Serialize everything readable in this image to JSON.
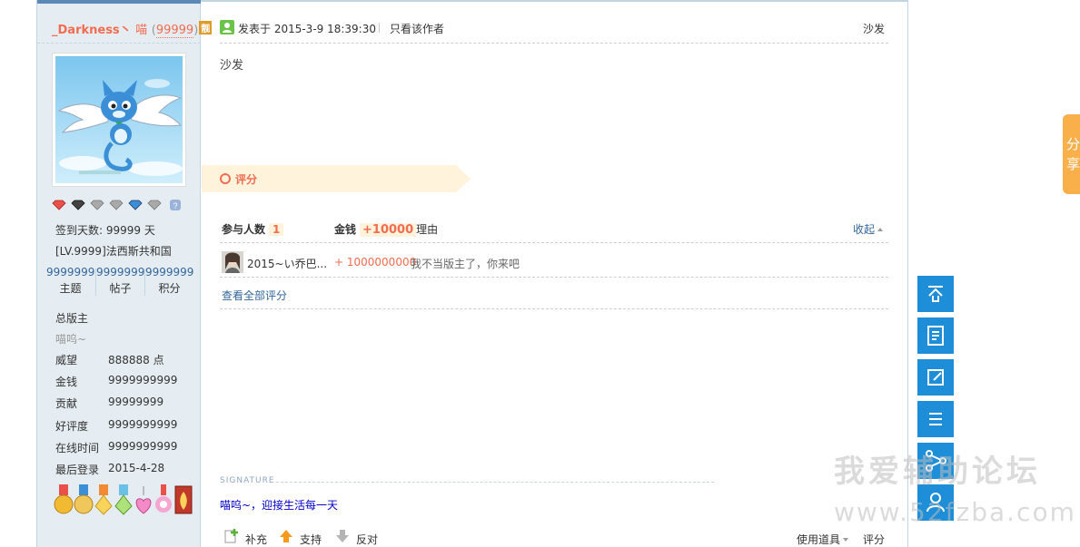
{
  "profile": {
    "username": "_Darkness丶",
    "meow": "喵",
    "uid": "99999",
    "tag": "靓",
    "sign_days_label": "签到天数: 99999 天",
    "level": "[LV.9999]法西斯共和国",
    "counts": [
      {
        "value": "9999999",
        "label": "主题"
      },
      {
        "value": "9999999",
        "label": "帖子"
      },
      {
        "value": "9999999",
        "label": "积分"
      }
    ],
    "group": "总版主",
    "custom_title": "喵呜~",
    "info": [
      {
        "key": "威望",
        "value": "888888 点"
      },
      {
        "key": "金钱",
        "value": "9999999999"
      },
      {
        "key": "贡献",
        "value": "99999999"
      },
      {
        "key": "好评度",
        "value": "9999999999"
      },
      {
        "key": "在线时间",
        "value": "9999999999"
      },
      {
        "key": "最后登录",
        "value": "2015-4-28"
      }
    ]
  },
  "post": {
    "posted_at": "发表于 2015-3-9 18:39:30",
    "only_author": "只看该作者",
    "floor": "沙发",
    "content": "沙发",
    "rating": {
      "title": "评分",
      "participants_label": "参与人数",
      "participants_count": "1",
      "money_label": "金钱",
      "money_total": "+10000",
      "reason_label": "理由",
      "collapse_label": "收起",
      "rows": [
        {
          "rater": "2015~い乔巴...",
          "amount": "+ 1000000000",
          "reason": "我不当版主了，你来吧"
        }
      ],
      "view_all": "查看全部评分"
    },
    "signature_label": "SIGNATURE",
    "signature": "喵呜~，迎接生活每一天",
    "actions": {
      "supplement": "补充",
      "support": "支持",
      "oppose": "反对",
      "use_tool": "使用道具",
      "rate": "评分"
    }
  },
  "side_toolbar": {
    "buttons": [
      "back-to-top",
      "return-list",
      "reply",
      "menu",
      "share",
      "user"
    ]
  },
  "share_tab": "分享",
  "watermark": {
    "line1": "我爱辅助论坛",
    "line2": "www.52fzba.com"
  },
  "colors": {
    "accent_orange": "#f26c4f",
    "link_blue": "#336699",
    "side_blue": "#1e8ed8",
    "share_orange": "#f9b04a",
    "profile_bg": "#e5edf2"
  }
}
